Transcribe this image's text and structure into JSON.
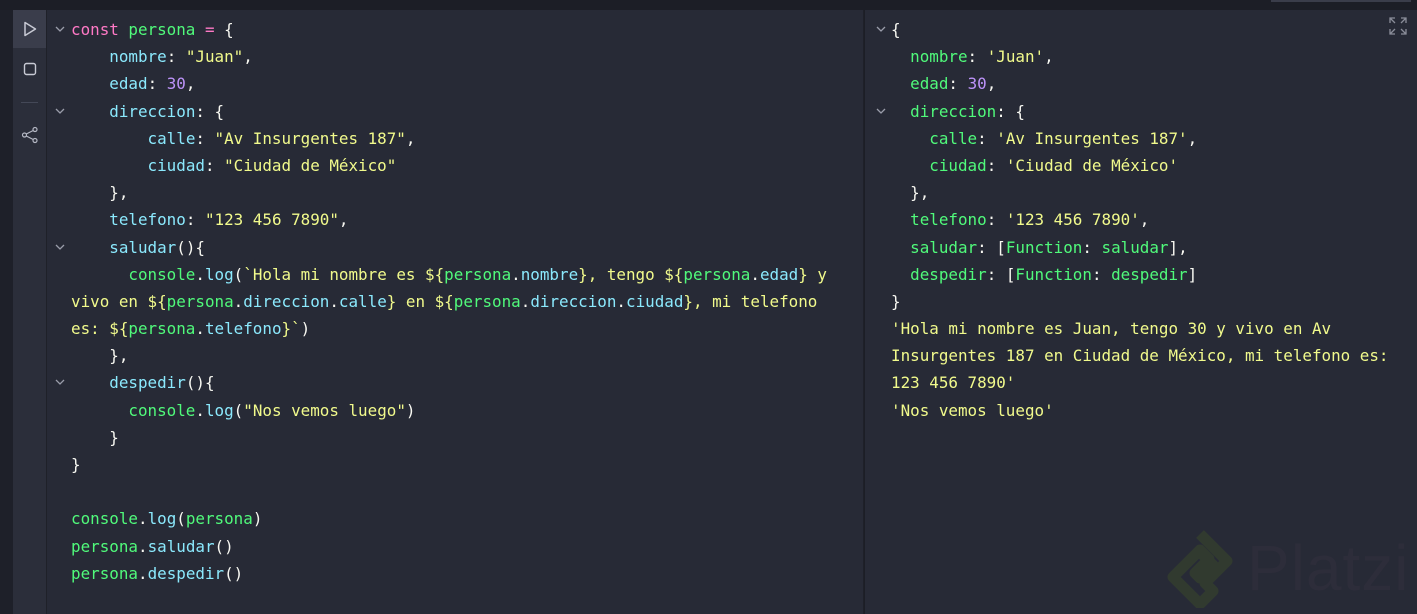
{
  "sidebar": {
    "buttons": [
      {
        "name": "run",
        "icon": "play-icon"
      },
      {
        "name": "stop",
        "icon": "stop-icon"
      },
      {
        "name": "share",
        "icon": "share-icon"
      }
    ]
  },
  "colors": {
    "keyword": "#ff79c6",
    "variable": "#50fa7b",
    "property": "#8be9fd",
    "string": "#f1fa8c",
    "number": "#bd93f9",
    "background": "#272a36"
  },
  "editor": {
    "folds": [
      0,
      3,
      8,
      13
    ],
    "lines": [
      [
        [
          "kw",
          "const "
        ],
        [
          "var",
          "persona"
        ],
        [
          "kw",
          " = "
        ],
        [
          "plain",
          "{"
        ]
      ],
      [
        [
          "plain",
          "    "
        ],
        [
          "prop",
          "nombre"
        ],
        [
          "plain",
          ": "
        ],
        [
          "str",
          "\"Juan\""
        ],
        [
          "plain",
          ","
        ]
      ],
      [
        [
          "plain",
          "    "
        ],
        [
          "prop",
          "edad"
        ],
        [
          "plain",
          ": "
        ],
        [
          "num",
          "30"
        ],
        [
          "plain",
          ","
        ]
      ],
      [
        [
          "plain",
          "    "
        ],
        [
          "prop",
          "direccion"
        ],
        [
          "plain",
          ": {"
        ]
      ],
      [
        [
          "plain",
          "        "
        ],
        [
          "prop",
          "calle"
        ],
        [
          "plain",
          ": "
        ],
        [
          "str",
          "\"Av Insurgentes 187\""
        ],
        [
          "plain",
          ","
        ]
      ],
      [
        [
          "plain",
          "        "
        ],
        [
          "prop",
          "ciudad"
        ],
        [
          "plain",
          ": "
        ],
        [
          "str",
          "\"Ciudad de México\""
        ]
      ],
      [
        [
          "plain",
          "    },"
        ]
      ],
      [
        [
          "plain",
          "    "
        ],
        [
          "prop",
          "telefono"
        ],
        [
          "plain",
          ": "
        ],
        [
          "str",
          "\"123 456 7890\""
        ],
        [
          "plain",
          ","
        ]
      ],
      [
        [
          "plain",
          "    "
        ],
        [
          "prop",
          "saludar"
        ],
        [
          "plain",
          "(){"
        ]
      ],
      [
        [
          "plain",
          "      "
        ],
        [
          "var",
          "console"
        ],
        [
          "plain",
          "."
        ],
        [
          "prop",
          "log"
        ],
        [
          "plain",
          "("
        ],
        [
          "str",
          "`Hola mi nombre es ${"
        ],
        [
          "var",
          "persona"
        ],
        [
          "plain",
          "."
        ],
        [
          "prop",
          "nombre"
        ],
        [
          "str",
          "}, tengo ${"
        ],
        [
          "var",
          "persona"
        ],
        [
          "plain",
          "."
        ],
        [
          "prop",
          "edad"
        ],
        [
          "str",
          "} y"
        ]
      ],
      [
        [
          "str",
          "vivo en ${"
        ],
        [
          "var",
          "persona"
        ],
        [
          "plain",
          "."
        ],
        [
          "prop",
          "direccion"
        ],
        [
          "plain",
          "."
        ],
        [
          "prop",
          "calle"
        ],
        [
          "str",
          "} en ${"
        ],
        [
          "var",
          "persona"
        ],
        [
          "plain",
          "."
        ],
        [
          "prop",
          "direccion"
        ],
        [
          "plain",
          "."
        ],
        [
          "prop",
          "ciudad"
        ],
        [
          "str",
          "}, mi telefono"
        ]
      ],
      [
        [
          "str",
          "es: ${"
        ],
        [
          "var",
          "persona"
        ],
        [
          "plain",
          "."
        ],
        [
          "prop",
          "telefono"
        ],
        [
          "str",
          "}`"
        ],
        [
          "plain",
          ")"
        ]
      ],
      [
        [
          "plain",
          "    },"
        ]
      ],
      [
        [
          "plain",
          "    "
        ],
        [
          "prop",
          "despedir"
        ],
        [
          "plain",
          "(){"
        ]
      ],
      [
        [
          "plain",
          "      "
        ],
        [
          "var",
          "console"
        ],
        [
          "plain",
          "."
        ],
        [
          "prop",
          "log"
        ],
        [
          "plain",
          "("
        ],
        [
          "str",
          "\"Nos vemos luego\""
        ],
        [
          "plain",
          ")"
        ]
      ],
      [
        [
          "plain",
          "    }"
        ]
      ],
      [
        [
          "plain",
          "}"
        ]
      ],
      [
        [
          "plain",
          ""
        ]
      ],
      [
        [
          "var",
          "console"
        ],
        [
          "plain",
          "."
        ],
        [
          "prop",
          "log"
        ],
        [
          "plain",
          "("
        ],
        [
          "var",
          "persona"
        ],
        [
          "plain",
          ")"
        ]
      ],
      [
        [
          "var",
          "persona"
        ],
        [
          "plain",
          "."
        ],
        [
          "prop",
          "saludar"
        ],
        [
          "plain",
          "()"
        ]
      ],
      [
        [
          "var",
          "persona"
        ],
        [
          "plain",
          "."
        ],
        [
          "prop",
          "despedir"
        ],
        [
          "plain",
          "()"
        ]
      ]
    ]
  },
  "output": {
    "folds": [
      0,
      3
    ],
    "lines": [
      [
        [
          "plain",
          "{"
        ]
      ],
      [
        [
          "plain",
          "  "
        ],
        [
          "oprop",
          "nombre"
        ],
        [
          "plain",
          ": "
        ],
        [
          "str",
          "'Juan'"
        ],
        [
          "plain",
          ","
        ]
      ],
      [
        [
          "plain",
          "  "
        ],
        [
          "oprop",
          "edad"
        ],
        [
          "plain",
          ": "
        ],
        [
          "num",
          "30"
        ],
        [
          "plain",
          ","
        ]
      ],
      [
        [
          "plain",
          "  "
        ],
        [
          "oprop",
          "direccion"
        ],
        [
          "plain",
          ": {"
        ]
      ],
      [
        [
          "plain",
          "    "
        ],
        [
          "oprop",
          "calle"
        ],
        [
          "plain",
          ": "
        ],
        [
          "str",
          "'Av Insurgentes 187'"
        ],
        [
          "plain",
          ","
        ]
      ],
      [
        [
          "plain",
          "    "
        ],
        [
          "oprop",
          "ciudad"
        ],
        [
          "plain",
          ": "
        ],
        [
          "str",
          "'Ciudad de México'"
        ]
      ],
      [
        [
          "plain",
          "  },"
        ]
      ],
      [
        [
          "plain",
          "  "
        ],
        [
          "oprop",
          "telefono"
        ],
        [
          "plain",
          ": "
        ],
        [
          "str",
          "'123 456 7890'"
        ],
        [
          "plain",
          ","
        ]
      ],
      [
        [
          "plain",
          "  "
        ],
        [
          "oprop",
          "saludar"
        ],
        [
          "plain",
          ": ["
        ],
        [
          "fn",
          "Function"
        ],
        [
          "plain",
          ": "
        ],
        [
          "fn",
          "saludar"
        ],
        [
          "plain",
          "],"
        ]
      ],
      [
        [
          "plain",
          "  "
        ],
        [
          "oprop",
          "despedir"
        ],
        [
          "plain",
          ": ["
        ],
        [
          "fn",
          "Function"
        ],
        [
          "plain",
          ": "
        ],
        [
          "fn",
          "despedir"
        ],
        [
          "plain",
          "]"
        ]
      ],
      [
        [
          "plain",
          "}"
        ]
      ],
      [
        [
          "str",
          "'Hola mi nombre es Juan, tengo 30 y vivo en Av"
        ]
      ],
      [
        [
          "str",
          "Insurgentes 187 en Ciudad de México, mi telefono es:"
        ]
      ],
      [
        [
          "str",
          "123 456 7890'"
        ]
      ],
      [
        [
          "str",
          "'Nos vemos luego'"
        ]
      ]
    ]
  },
  "watermark": {
    "text": "Platzi"
  }
}
